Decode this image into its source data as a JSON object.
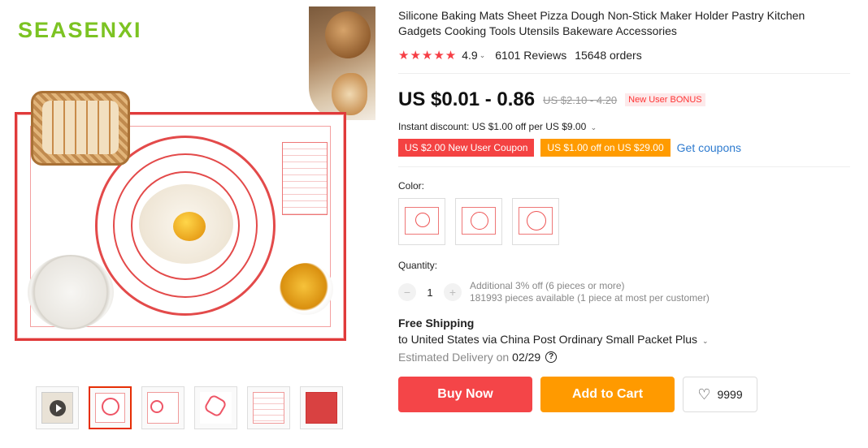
{
  "brand": {
    "logo_text": "SEASENXI"
  },
  "product": {
    "title": "Silicone Baking Mats Sheet Pizza Dough Non-Stick Maker Holder Pastry Kitchen Gadgets Cooking Tools Utensils Bakeware Accessories",
    "stars": "★★★★★",
    "rating": "4.9",
    "reviews": "6101 Reviews",
    "orders": "15648 orders"
  },
  "price": {
    "current": "US $0.01 - 0.86",
    "original": "US $2.10 - 4.20",
    "bonus_badge": "New User BONUS"
  },
  "discounts": {
    "instant": "Instant discount: US $1.00 off per US $9.00",
    "coupon_1": "US $2.00 New User Coupon",
    "coupon_2": "US $1.00 off on US $29.00",
    "get_coupons": "Get coupons"
  },
  "color": {
    "label": "Color:",
    "options": 3
  },
  "quantity": {
    "label": "Quantity:",
    "minus": "−",
    "value": "1",
    "plus": "+",
    "info_line_1": "Additional 3% off (6 pieces or more)",
    "info_line_2": "181993 pieces available (1 piece at most per customer)"
  },
  "shipping": {
    "title": "Free Shipping",
    "method": "to United States via China Post Ordinary Small Packet Plus",
    "delivery_label": "Estimated Delivery on",
    "delivery_date": "02/29",
    "help": "?"
  },
  "actions": {
    "buy_now": "Buy Now",
    "add_to_cart": "Add to Cart",
    "wishlist_count": "9999"
  },
  "colors": {
    "accent_red": "#f44548",
    "accent_orange": "#ff9a00",
    "star_red": "#f63e45",
    "link_blue": "#2e7bcf",
    "logo_green": "#7cc322"
  },
  "icons": {
    "chevron": "⌄",
    "heart": "♡"
  }
}
